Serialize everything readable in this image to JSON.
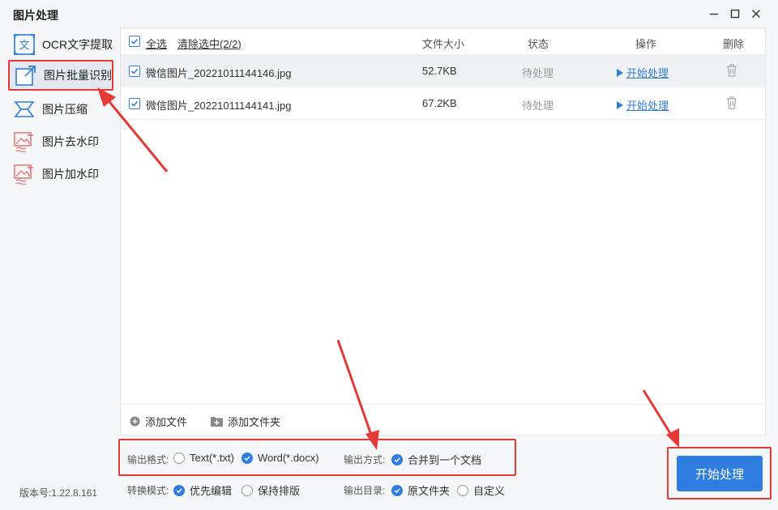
{
  "app": {
    "title": "图片处理"
  },
  "colors": {
    "accent": "#2f7de1",
    "highlight": "#e53935"
  },
  "sidebar": {
    "items": [
      {
        "label": "OCR文字提取",
        "icon": "ocr-text-icon"
      },
      {
        "label": "图片批量识别",
        "icon": "batch-recognize-icon",
        "active": true
      },
      {
        "label": "图片压缩",
        "icon": "compress-icon"
      },
      {
        "label": "图片去水印",
        "icon": "remove-watermark-icon"
      },
      {
        "label": "图片加水印",
        "icon": "add-watermark-icon"
      }
    ],
    "version": "版本号:1.22.8.161"
  },
  "table": {
    "header": {
      "select_all": "全选",
      "clear_selection": "清除选中(2/2)",
      "size": "文件大小",
      "status": "状态",
      "action": "操作",
      "delete": "删除"
    },
    "rows": [
      {
        "name": "微信图片_20221011144146.jpg",
        "size": "52.7KB",
        "status": "待处理",
        "action": "开始处理"
      },
      {
        "name": "微信图片_20221011144141.jpg",
        "size": "67.2KB",
        "status": "待处理",
        "action": "开始处理"
      }
    ]
  },
  "footer": {
    "add_file": "添加文件",
    "add_folder": "添加文件夹"
  },
  "options": {
    "format": {
      "label": "输出格式:",
      "choices": [
        "Text(*.txt)",
        "Word(*.docx)"
      ],
      "selected": "Word(*.docx)"
    },
    "method": {
      "label": "输出方式:",
      "choices": [
        "合并到一个文档"
      ],
      "selected": "合并到一个文档"
    },
    "mode": {
      "label": "转换模式:",
      "choices": [
        "优先编辑",
        "保持排版"
      ],
      "selected": "优先编辑"
    },
    "dir": {
      "label": "输出目录:",
      "choices": [
        "原文件夹",
        "自定义"
      ],
      "selected": "原文件夹"
    }
  },
  "start_button": "开始处理"
}
